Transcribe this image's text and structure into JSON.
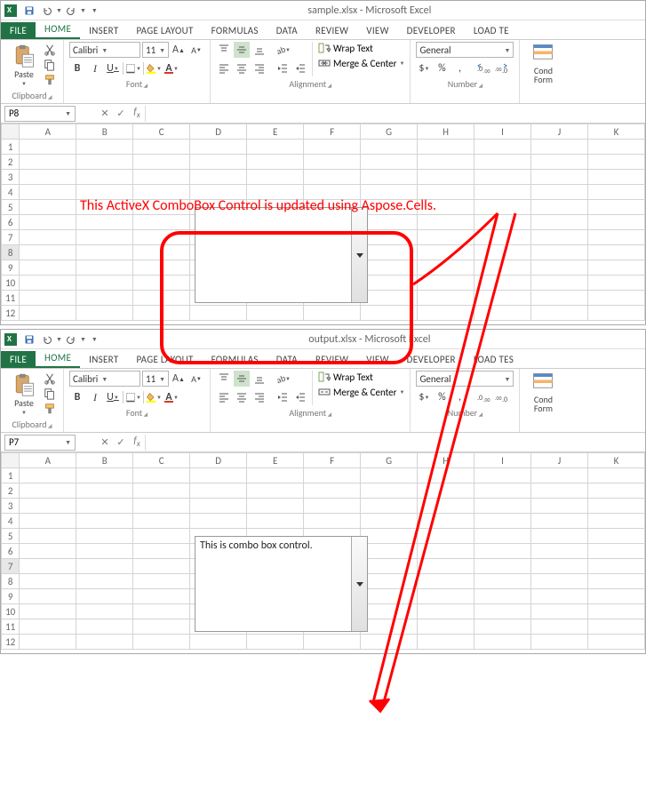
{
  "annotation": {
    "text": "This ActiveX ComboBox Control is updated using Aspose.Cells."
  },
  "windows": [
    {
      "title": "sample.xlsx - Microsoft Excel",
      "tabs": {
        "file": "FILE",
        "home": "HOME",
        "insert": "INSERT",
        "page_layout": "PAGE LAYOUT",
        "formulas": "FORMULAS",
        "data": "DATA",
        "review": "REVIEW",
        "view": "VIEW",
        "developer": "DEVELOPER",
        "loadtest": "LOAD TE"
      },
      "ribbon": {
        "clipboard": {
          "label": "Clipboard",
          "paste": "Paste"
        },
        "font": {
          "label": "Font",
          "name": "Calibri",
          "size": "11",
          "bold": "B",
          "italic": "I",
          "underline": "U"
        },
        "alignment": {
          "label": "Alignment",
          "wrap": "Wrap Text",
          "merge": "Merge & Center"
        },
        "number": {
          "label": "Number",
          "format": "General",
          "currency": "$",
          "percent": "%",
          "comma": ","
        },
        "cond": {
          "label": "Cond\nForm"
        }
      },
      "namebox": "P8",
      "columns": [
        "A",
        "B",
        "C",
        "D",
        "E",
        "F",
        "G",
        "H",
        "I",
        "J",
        "K"
      ],
      "rows": [
        "1",
        "2",
        "3",
        "4",
        "5",
        "6",
        "7",
        "8",
        "9",
        "10",
        "11",
        "12"
      ],
      "selected_row": "8",
      "combobox_text": ""
    },
    {
      "title": "output.xlsx - Microsoft Excel",
      "tabs": {
        "file": "FILE",
        "home": "HOME",
        "insert": "INSERT",
        "page_layout": "PAGE LAYOUT",
        "formulas": "FORMULAS",
        "data": "DATA",
        "review": "REVIEW",
        "view": "VIEW",
        "developer": "DEVELOPER",
        "loadtest": "LOAD TES"
      },
      "ribbon": {
        "clipboard": {
          "label": "Clipboard",
          "paste": "Paste"
        },
        "font": {
          "label": "Font",
          "name": "Calibri",
          "size": "11",
          "bold": "B",
          "italic": "I",
          "underline": "U"
        },
        "alignment": {
          "label": "Alignment",
          "wrap": "Wrap Text",
          "merge": "Merge & Center"
        },
        "number": {
          "label": "Number",
          "format": "General",
          "currency": "$",
          "percent": "%",
          "comma": ","
        },
        "cond": {
          "label": "Cond\nForm"
        }
      },
      "namebox": "P7",
      "columns": [
        "A",
        "B",
        "C",
        "D",
        "E",
        "F",
        "G",
        "H",
        "I",
        "J",
        "K"
      ],
      "rows": [
        "1",
        "2",
        "3",
        "4",
        "5",
        "6",
        "7",
        "8",
        "9",
        "10",
        "11",
        "12"
      ],
      "selected_row": "7",
      "combobox_text": "This is combo box control."
    }
  ]
}
